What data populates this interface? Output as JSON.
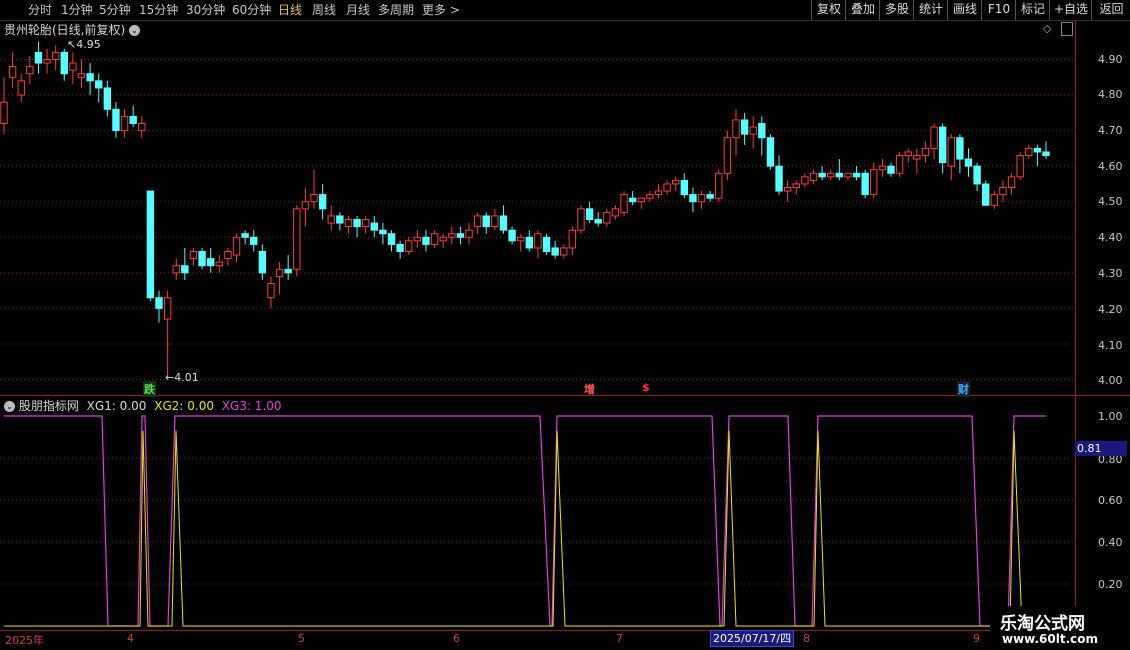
{
  "toolbar": {
    "periods": [
      "分时",
      "1分钟",
      "5分钟",
      "15分钟",
      "30分钟",
      "60分钟",
      "日线",
      "周线",
      "月线",
      "多周期",
      "更多 >"
    ],
    "active_index": 6,
    "right": [
      "复权",
      "叠加",
      "多股",
      "统计",
      "画线",
      "F10",
      "标记",
      "+自选",
      "返回"
    ]
  },
  "chart_header": {
    "stock": "贵州轮胎(日线,前复权)"
  },
  "price_axis": [
    "4.90",
    "4.80",
    "4.70",
    "4.60",
    "4.50",
    "4.40",
    "4.30",
    "4.20",
    "4.10",
    "4.00"
  ],
  "annotations": {
    "high": "4.95",
    "low": "4.01"
  },
  "markers": [
    {
      "text": "跌",
      "color": "#5cd65c"
    },
    {
      "text": "增",
      "color": "#ff5555"
    },
    {
      "text": "$",
      "color": "#ff3333"
    },
    {
      "text": "财",
      "color": "#44aaff"
    }
  ],
  "indicator": {
    "name": "股朋指标网",
    "xg1_label": "XG1: 0.00",
    "xg2_label": "XG2: 0.00",
    "xg3_label": "XG3: 1.00",
    "axis": [
      "1.00",
      "0.80",
      "0.60",
      "0.40",
      "0.20"
    ],
    "cursor_value": "0.81",
    "colors": {
      "xg2": "#e8e800",
      "xg3": "#e040e0"
    }
  },
  "x_axis": {
    "labels": [
      "2025年",
      "4",
      "5",
      "6",
      "7",
      "8",
      "9"
    ],
    "cursor_date": "2025/07/17/四"
  },
  "watermark": {
    "title": "乐淘公式网",
    "url": "www.60lt.com"
  },
  "chart_data": {
    "type": "candlestick",
    "ylim": [
      4.0,
      4.95
    ],
    "candles": [
      [
        4.72,
        4.85,
        4.69,
        4.78
      ],
      [
        4.85,
        4.92,
        4.82,
        4.88
      ],
      [
        4.8,
        4.86,
        4.78,
        4.84
      ],
      [
        4.86,
        4.91,
        4.83,
        4.88
      ],
      [
        4.92,
        4.95,
        4.86,
        4.89
      ],
      [
        4.89,
        4.93,
        4.86,
        4.9
      ],
      [
        4.9,
        4.94,
        4.87,
        4.92
      ],
      [
        4.92,
        4.93,
        4.84,
        4.86
      ],
      [
        4.87,
        4.92,
        4.83,
        4.89
      ],
      [
        4.85,
        4.9,
        4.82,
        4.86
      ],
      [
        4.86,
        4.89,
        4.8,
        4.84
      ],
      [
        4.84,
        4.86,
        4.78,
        4.82
      ],
      [
        4.82,
        4.84,
        4.74,
        4.76
      ],
      [
        4.76,
        4.78,
        4.68,
        4.7
      ],
      [
        4.7,
        4.76,
        4.68,
        4.74
      ],
      [
        4.74,
        4.77,
        4.71,
        4.72
      ],
      [
        4.7,
        4.74,
        4.68,
        4.72
      ],
      [
        4.53,
        4.53,
        4.22,
        4.23
      ],
      [
        4.23,
        4.25,
        4.16,
        4.2
      ],
      [
        4.17,
        4.25,
        4.01,
        4.23
      ],
      [
        4.3,
        4.34,
        4.28,
        4.32
      ],
      [
        4.32,
        4.37,
        4.28,
        4.3
      ],
      [
        4.34,
        4.37,
        4.32,
        4.36
      ],
      [
        4.36,
        4.37,
        4.31,
        4.32
      ],
      [
        4.34,
        4.37,
        4.3,
        4.32
      ],
      [
        4.32,
        4.35,
        4.3,
        4.33
      ],
      [
        4.34,
        4.37,
        4.32,
        4.36
      ],
      [
        4.35,
        4.41,
        4.33,
        4.4
      ],
      [
        4.41,
        4.42,
        4.38,
        4.4
      ],
      [
        4.4,
        4.42,
        4.36,
        4.38
      ],
      [
        4.36,
        4.38,
        4.28,
        4.3
      ],
      [
        4.23,
        4.29,
        4.2,
        4.27
      ],
      [
        4.29,
        4.33,
        4.24,
        4.31
      ],
      [
        4.31,
        4.35,
        4.28,
        4.3
      ],
      [
        4.31,
        4.49,
        4.29,
        4.48
      ],
      [
        4.48,
        4.54,
        4.43,
        4.5
      ],
      [
        4.5,
        4.59,
        4.48,
        4.52
      ],
      [
        4.52,
        4.55,
        4.45,
        4.48
      ],
      [
        4.44,
        4.49,
        4.42,
        4.46
      ],
      [
        4.46,
        4.47,
        4.42,
        4.44
      ],
      [
        4.43,
        4.46,
        4.41,
        4.45
      ],
      [
        4.45,
        4.46,
        4.4,
        4.43
      ],
      [
        4.43,
        4.46,
        4.41,
        4.45
      ],
      [
        4.44,
        4.46,
        4.4,
        4.42
      ],
      [
        4.42,
        4.44,
        4.38,
        4.41
      ],
      [
        4.41,
        4.42,
        4.36,
        4.38
      ],
      [
        4.38,
        4.39,
        4.34,
        4.36
      ],
      [
        4.36,
        4.4,
        4.35,
        4.39
      ],
      [
        4.39,
        4.42,
        4.37,
        4.4
      ],
      [
        4.4,
        4.42,
        4.36,
        4.38
      ],
      [
        4.38,
        4.42,
        4.37,
        4.41
      ],
      [
        4.39,
        4.41,
        4.37,
        4.4
      ],
      [
        4.4,
        4.43,
        4.38,
        4.41
      ],
      [
        4.41,
        4.43,
        4.38,
        4.4
      ],
      [
        4.4,
        4.44,
        4.38,
        4.42
      ],
      [
        4.43,
        4.47,
        4.41,
        4.46
      ],
      [
        4.46,
        4.47,
        4.41,
        4.43
      ],
      [
        4.43,
        4.48,
        4.42,
        4.46
      ],
      [
        4.46,
        4.49,
        4.41,
        4.42
      ],
      [
        4.42,
        4.43,
        4.38,
        4.39
      ],
      [
        4.39,
        4.41,
        4.36,
        4.4
      ],
      [
        4.4,
        4.42,
        4.36,
        4.37
      ],
      [
        4.37,
        4.42,
        4.34,
        4.41
      ],
      [
        4.4,
        4.41,
        4.35,
        4.36
      ],
      [
        4.37,
        4.39,
        4.34,
        4.35
      ],
      [
        4.35,
        4.38,
        4.34,
        4.37
      ],
      [
        4.37,
        4.43,
        4.35,
        4.42
      ],
      [
        4.42,
        4.49,
        4.41,
        4.48
      ],
      [
        4.48,
        4.5,
        4.44,
        4.45
      ],
      [
        4.45,
        4.47,
        4.43,
        4.44
      ],
      [
        4.44,
        4.48,
        4.43,
        4.47
      ],
      [
        4.46,
        4.49,
        4.45,
        4.48
      ],
      [
        4.47,
        4.53,
        4.46,
        4.52
      ],
      [
        4.51,
        4.53,
        4.49,
        4.5
      ],
      [
        4.5,
        4.51,
        4.48,
        4.51
      ],
      [
        4.51,
        4.53,
        4.5,
        4.52
      ],
      [
        4.52,
        4.55,
        4.51,
        4.53
      ],
      [
        4.53,
        4.56,
        4.52,
        4.55
      ],
      [
        4.55,
        4.57,
        4.53,
        4.56
      ],
      [
        4.56,
        4.58,
        4.51,
        4.52
      ],
      [
        4.52,
        4.54,
        4.47,
        4.5
      ],
      [
        4.5,
        4.53,
        4.48,
        4.52
      ],
      [
        4.52,
        4.53,
        4.5,
        4.51
      ],
      [
        4.51,
        4.59,
        4.5,
        4.58
      ],
      [
        4.58,
        4.7,
        4.56,
        4.68
      ],
      [
        4.68,
        4.76,
        4.63,
        4.73
      ],
      [
        4.73,
        4.75,
        4.66,
        4.69
      ],
      [
        4.69,
        4.74,
        4.65,
        4.71
      ],
      [
        4.72,
        4.74,
        4.63,
        4.68
      ],
      [
        4.68,
        4.69,
        4.59,
        4.6
      ],
      [
        4.6,
        4.63,
        4.52,
        4.53
      ],
      [
        4.53,
        4.56,
        4.5,
        4.54
      ],
      [
        4.54,
        4.56,
        4.52,
        4.55
      ],
      [
        4.55,
        4.58,
        4.54,
        4.57
      ],
      [
        4.56,
        4.59,
        4.55,
        4.58
      ],
      [
        4.58,
        4.6,
        4.56,
        4.57
      ],
      [
        4.57,
        4.59,
        4.56,
        4.58
      ],
      [
        4.58,
        4.62,
        4.56,
        4.57
      ],
      [
        4.57,
        4.58,
        4.56,
        4.58
      ],
      [
        4.58,
        4.6,
        4.56,
        4.57
      ],
      [
        4.58,
        4.59,
        4.51,
        4.52
      ],
      [
        4.52,
        4.61,
        4.51,
        4.59
      ],
      [
        4.59,
        4.62,
        4.57,
        4.6
      ],
      [
        4.6,
        4.61,
        4.57,
        4.58
      ],
      [
        4.58,
        4.64,
        4.57,
        4.63
      ],
      [
        4.63,
        4.65,
        4.61,
        4.64
      ],
      [
        4.62,
        4.65,
        4.58,
        4.63
      ],
      [
        4.63,
        4.67,
        4.61,
        4.65
      ],
      [
        4.65,
        4.72,
        4.62,
        4.71
      ],
      [
        4.71,
        4.72,
        4.58,
        4.61
      ],
      [
        4.6,
        4.69,
        4.56,
        4.68
      ],
      [
        4.68,
        4.69,
        4.58,
        4.62
      ],
      [
        4.62,
        4.65,
        4.57,
        4.6
      ],
      [
        4.6,
        4.61,
        4.53,
        4.55
      ],
      [
        4.55,
        4.56,
        4.49,
        4.49
      ],
      [
        4.49,
        4.53,
        4.48,
        4.52
      ],
      [
        4.52,
        4.56,
        4.5,
        4.54
      ],
      [
        4.54,
        4.58,
        4.52,
        4.57
      ],
      [
        4.57,
        4.64,
        4.56,
        4.63
      ],
      [
        4.63,
        4.66,
        4.62,
        4.65
      ],
      [
        4.65,
        4.66,
        4.6,
        4.64
      ],
      [
        4.64,
        4.67,
        4.62,
        4.63
      ]
    ],
    "indicator_series": [
      {
        "name": "XG2",
        "values": [
          [
            0,
            0
          ],
          [
            1,
            0
          ],
          [
            4,
            0.26
          ],
          [
            4.2,
            0.96
          ],
          [
            5,
            0.96
          ],
          [
            5.2,
            0.85
          ],
          [
            6,
            0.02
          ],
          [
            10,
            0.02
          ],
          [
            10.2,
            0.96
          ],
          [
            11,
            0.02
          ],
          [
            28,
            0.02
          ],
          [
            28.2,
            0.96
          ],
          [
            29,
            0.02
          ],
          [
            33,
            0.02
          ],
          [
            33.2,
            0.96
          ],
          [
            34,
            0.02
          ],
          [
            37,
            0.02
          ],
          [
            38,
            0.96
          ],
          [
            38.2,
            0.02
          ],
          [
            44,
            0.02
          ],
          [
            44.2,
            0.96
          ],
          [
            45,
            0.02
          ],
          [
            48,
            0.02
          ],
          [
            48.2,
            0.96
          ],
          [
            49,
            0.02
          ],
          [
            55,
            0.02
          ]
        ]
      },
      {
        "name": "XG3",
        "values": [
          [
            0,
            0.02
          ],
          [
            1,
            0.02
          ],
          [
            2,
            0.96
          ],
          [
            3.5,
            0.96
          ]
        ]
      }
    ]
  }
}
